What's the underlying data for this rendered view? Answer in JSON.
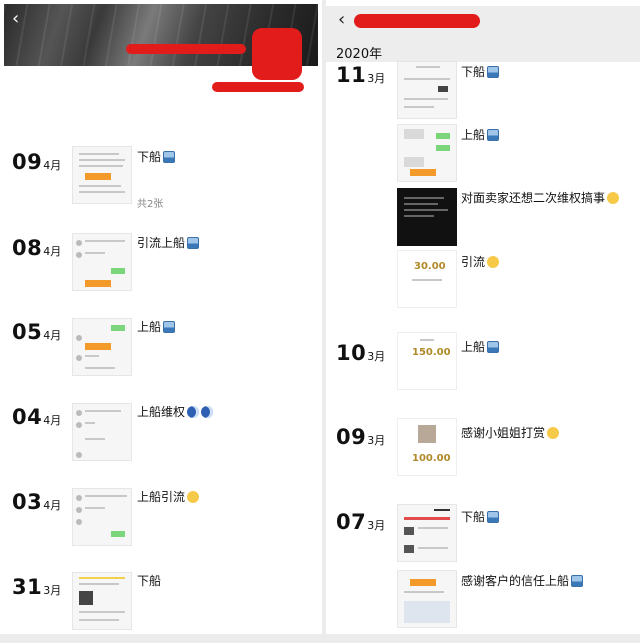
{
  "left": {
    "back_icon": "chevron-left-icon",
    "entries": [
      {
        "day": "09",
        "month": "4月",
        "caption": "下船",
        "emoji": "ship-emoji",
        "count": "共2张"
      },
      {
        "day": "08",
        "month": "4月",
        "caption": "引流上船",
        "emoji": "ship-emoji"
      },
      {
        "day": "05",
        "month": "4月",
        "caption": "上船",
        "emoji": "ship-emoji"
      },
      {
        "day": "04",
        "month": "4月",
        "caption": "上船维权",
        "emoji": "moon-emoji"
      },
      {
        "day": "03",
        "month": "4月",
        "caption": "上船引流",
        "emoji": "smile-emoji"
      },
      {
        "day": "31",
        "month": "3月",
        "caption": "下船"
      }
    ]
  },
  "right": {
    "back_icon": "chevron-left-icon",
    "year": "2020年",
    "entries": [
      {
        "day": "11",
        "month": "3月",
        "posts": [
          {
            "caption": "下船",
            "emoji": "ship-emoji"
          },
          {
            "caption": "上船",
            "emoji": "ship-emoji"
          },
          {
            "caption": "对面卖家还想二次维权搞事",
            "emoji": "smile-emoji"
          },
          {
            "caption": "引流",
            "emoji": "smile-emoji",
            "amount": "30.00"
          }
        ]
      },
      {
        "day": "10",
        "month": "3月",
        "posts": [
          {
            "caption": "上船",
            "emoji": "ship-emoji",
            "amount": "150.00"
          }
        ]
      },
      {
        "day": "09",
        "month": "3月",
        "posts": [
          {
            "caption": "感谢小姐姐打赏",
            "emoji": "smile-emoji",
            "amount": "100.00"
          }
        ]
      },
      {
        "day": "07",
        "month": "3月",
        "posts": [
          {
            "caption": "下船",
            "emoji": "ship-emoji"
          },
          {
            "caption": "感谢客户的信任上船",
            "emoji": "ship-emoji"
          }
        ]
      }
    ]
  },
  "colors": {
    "redaction": "#e21b1b",
    "chat_green": "#7bd67b",
    "transfer_orange": "#f39a2a"
  }
}
